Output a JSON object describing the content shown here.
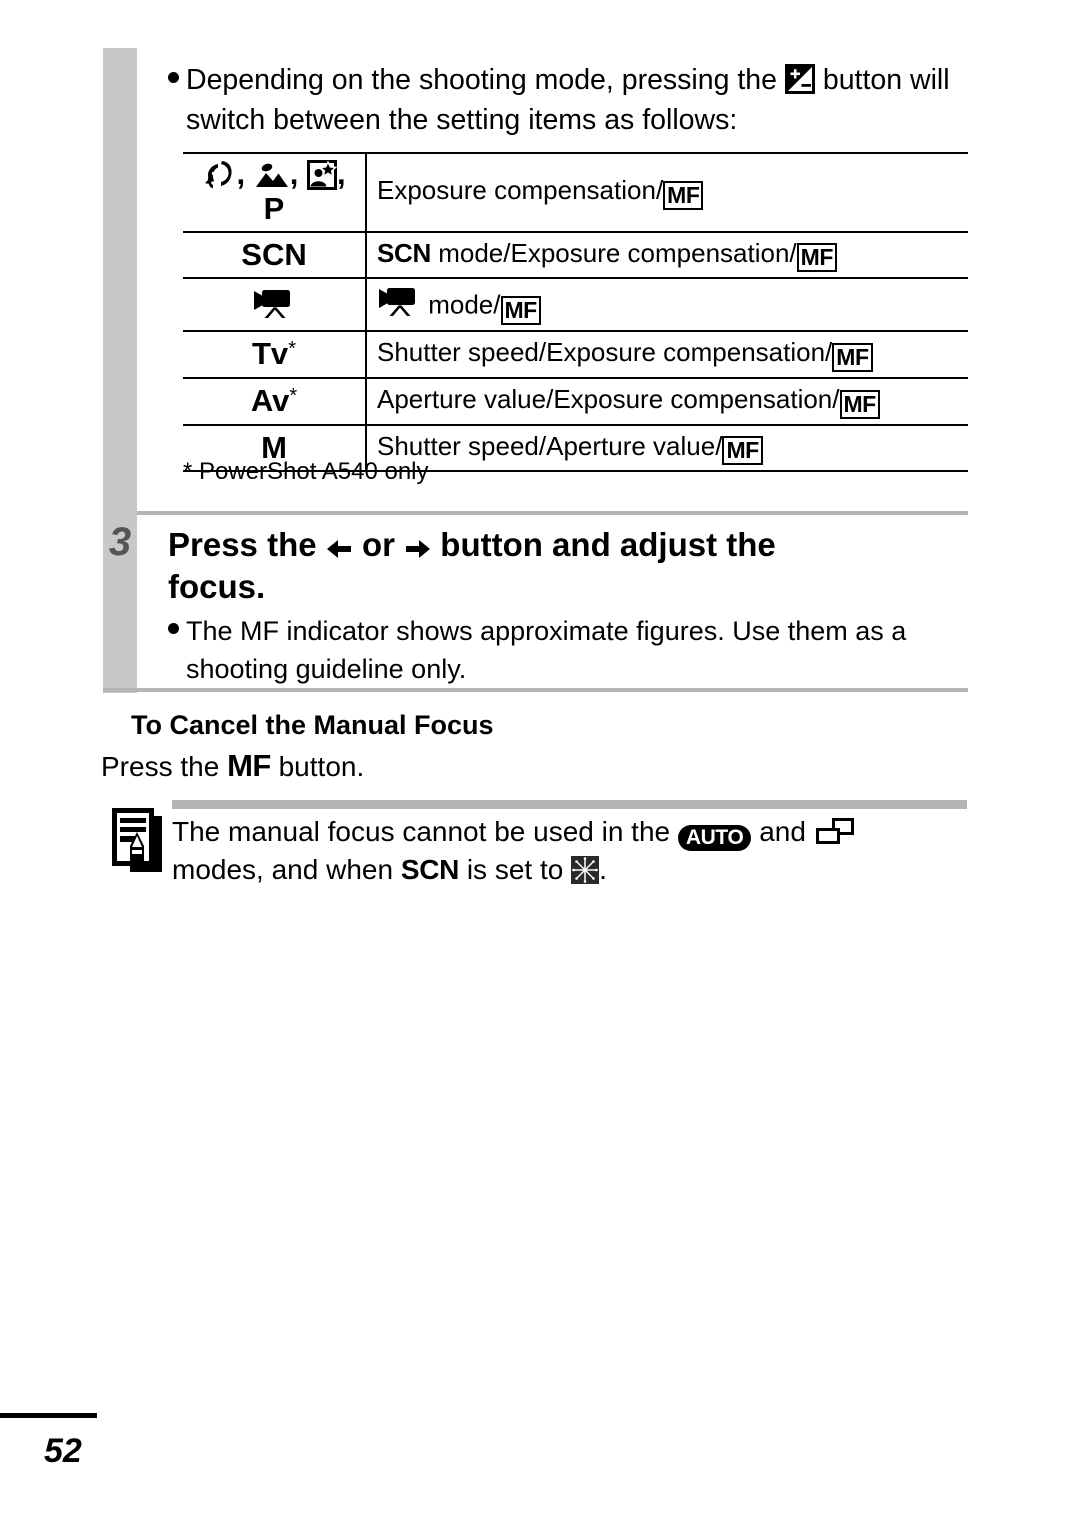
{
  "page": {
    "number": "52"
  },
  "intro": {
    "line1_before": "Depending on the shooting mode, pressing the",
    "line1_after": "button",
    "line2": "will switch between the setting items as follows:",
    "button_icon": "exposure-compensation-icon"
  },
  "mode_table": {
    "rows": [
      {
        "mode_icons": [
          "portrait-icon",
          "landscape-icon",
          "night-scene-icon"
        ],
        "mode_label": "P",
        "desc_before": "Exposure compensation/",
        "desc_icon": "MF"
      },
      {
        "mode_label": "SCN",
        "desc_prefix_bold": "SCN",
        "desc_before": " mode/Exposure compensation/",
        "desc_icon": "MF"
      },
      {
        "mode_icons": [
          "movie-icon"
        ],
        "mode_label": "",
        "desc_icon_prefix": "movie-icon",
        "desc_before": " mode/",
        "desc_icon": "MF"
      },
      {
        "mode_label": "Tv",
        "mode_star": "*",
        "desc_before": "Shutter speed/Exposure compensation/",
        "desc_icon": "MF"
      },
      {
        "mode_label": "Av",
        "mode_star": "*",
        "desc_before": "Aperture value/Exposure compensation/",
        "desc_icon": "MF"
      },
      {
        "mode_label": "M",
        "desc_before": "Shutter speed/Aperture value/",
        "desc_icon": "MF"
      }
    ],
    "footnote": "* PowerShot A540 only"
  },
  "step3": {
    "number": "3",
    "title_part1": "Press the",
    "title_or": "or",
    "title_part2": "button and adjust the",
    "title_line2": "focus.",
    "left_arrow_icon": "arrow-left-icon",
    "right_arrow_icon": "arrow-right-icon",
    "bullet": "The MF indicator shows approximate figures. Use them as a shooting guideline only."
  },
  "cancel_section": {
    "heading": "To Cancel the Manual Focus",
    "text_before": "Press the",
    "mf_label": "MF",
    "text_after": "button."
  },
  "note": {
    "icon": "memo-pencil-icon",
    "text_before": "The manual focus cannot be used in the",
    "auto_label": "AUTO",
    "text_mid": "and",
    "stitch_icon": "stitch-assist-icon",
    "text_after": "modes, and when",
    "scn_label": "SCN",
    "text_end": "is set to",
    "fireworks_icon": "fireworks-icon",
    "period": "."
  },
  "colors": {
    "step_bar": "#c8c8c8",
    "step_number": "#555555",
    "rule_gray": "#b5b5b5",
    "ink": "#000000"
  }
}
